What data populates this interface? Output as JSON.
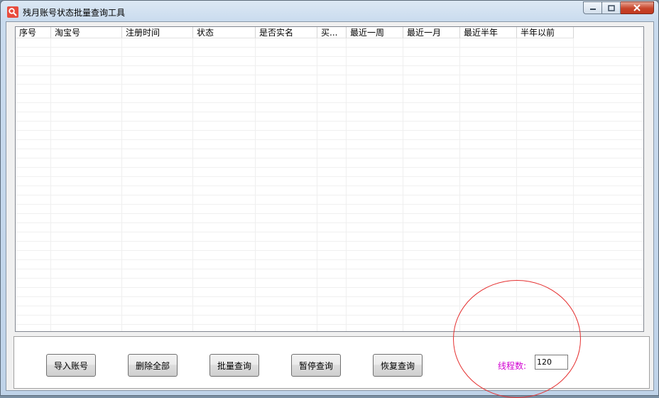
{
  "window": {
    "title": "残月账号状态批量查询工具",
    "icon": "search-icon",
    "controls": [
      "minimize-icon",
      "maximize-icon",
      "close-icon"
    ]
  },
  "table": {
    "columns": [
      "序号",
      "淘宝号",
      "注册时间",
      "状态",
      "是否实名",
      "买...",
      "最近一周",
      "最近一月",
      "最近半年",
      "半年以前"
    ],
    "rows": []
  },
  "buttons": {
    "import": "导入账号",
    "delete_all": "删除全部",
    "batch_query": "批量查询",
    "pause": "暂停查询",
    "resume": "恢复查询"
  },
  "threads": {
    "label": "线程数:",
    "value": "120"
  },
  "colors": {
    "thread_label": "#d100d1",
    "annotation": "#e53030",
    "close_button": "#c7452b"
  }
}
